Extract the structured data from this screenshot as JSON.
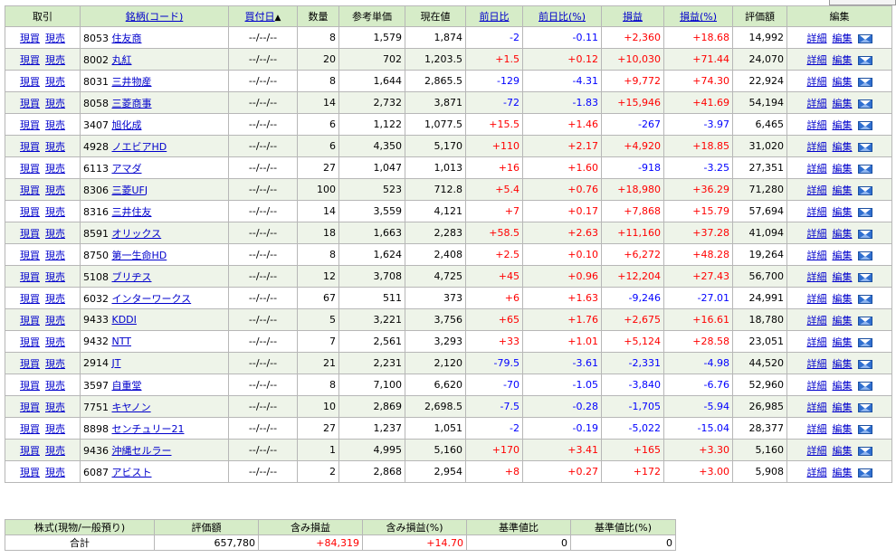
{
  "headers": {
    "trade": "取引",
    "stock": "銘柄(コード)",
    "buy_date": "買付日",
    "sort_indicator": "▲",
    "qty": "数量",
    "ref_price": "参考単価",
    "current_price": "現在値",
    "prev_diff": "前日比",
    "prev_diff_pct": "前日比(%)",
    "pl": "損益",
    "pl_pct": "損益(%)",
    "valuation": "評価額",
    "edit": "編集"
  },
  "labels": {
    "buy": "現買",
    "sell": "現売",
    "detail": "詳細",
    "edit": "編集",
    "mail_icon": "mail-icon"
  },
  "rows": [
    {
      "code": "8053",
      "name": "住友商",
      "date": "--/--/--",
      "qty": "8",
      "ref": "1,579",
      "cur": "1,874",
      "diff": "-2",
      "diffp": "-0.11",
      "pl": "+2,360",
      "plp": "+18.68",
      "val": "14,992"
    },
    {
      "code": "8002",
      "name": "丸紅",
      "date": "--/--/--",
      "qty": "20",
      "ref": "702",
      "cur": "1,203.5",
      "diff": "+1.5",
      "diffp": "+0.12",
      "pl": "+10,030",
      "plp": "+71.44",
      "val": "24,070"
    },
    {
      "code": "8031",
      "name": "三井物産",
      "date": "--/--/--",
      "qty": "8",
      "ref": "1,644",
      "cur": "2,865.5",
      "diff": "-129",
      "diffp": "-4.31",
      "pl": "+9,772",
      "plp": "+74.30",
      "val": "22,924"
    },
    {
      "code": "8058",
      "name": "三菱商事",
      "date": "--/--/--",
      "qty": "14",
      "ref": "2,732",
      "cur": "3,871",
      "diff": "-72",
      "diffp": "-1.83",
      "pl": "+15,946",
      "plp": "+41.69",
      "val": "54,194"
    },
    {
      "code": "3407",
      "name": "旭化成",
      "date": "--/--/--",
      "qty": "6",
      "ref": "1,122",
      "cur": "1,077.5",
      "diff": "+15.5",
      "diffp": "+1.46",
      "pl": "-267",
      "plp": "-3.97",
      "val": "6,465"
    },
    {
      "code": "4928",
      "name": "ノエビアHD",
      "date": "--/--/--",
      "qty": "6",
      "ref": "4,350",
      "cur": "5,170",
      "diff": "+110",
      "diffp": "+2.17",
      "pl": "+4,920",
      "plp": "+18.85",
      "val": "31,020"
    },
    {
      "code": "6113",
      "name": "アマダ",
      "date": "--/--/--",
      "qty": "27",
      "ref": "1,047",
      "cur": "1,013",
      "diff": "+16",
      "diffp": "+1.60",
      "pl": "-918",
      "plp": "-3.25",
      "val": "27,351"
    },
    {
      "code": "8306",
      "name": "三菱UFJ",
      "date": "--/--/--",
      "qty": "100",
      "ref": "523",
      "cur": "712.8",
      "diff": "+5.4",
      "diffp": "+0.76",
      "pl": "+18,980",
      "plp": "+36.29",
      "val": "71,280"
    },
    {
      "code": "8316",
      "name": "三井住友",
      "date": "--/--/--",
      "qty": "14",
      "ref": "3,559",
      "cur": "4,121",
      "diff": "+7",
      "diffp": "+0.17",
      "pl": "+7,868",
      "plp": "+15.79",
      "val": "57,694"
    },
    {
      "code": "8591",
      "name": "オリックス",
      "date": "--/--/--",
      "qty": "18",
      "ref": "1,663",
      "cur": "2,283",
      "diff": "+58.5",
      "diffp": "+2.63",
      "pl": "+11,160",
      "plp": "+37.28",
      "val": "41,094"
    },
    {
      "code": "8750",
      "name": "第一生命HD",
      "date": "--/--/--",
      "qty": "8",
      "ref": "1,624",
      "cur": "2,408",
      "diff": "+2.5",
      "diffp": "+0.10",
      "pl": "+6,272",
      "plp": "+48.28",
      "val": "19,264"
    },
    {
      "code": "5108",
      "name": "ブリヂス",
      "date": "--/--/--",
      "qty": "12",
      "ref": "3,708",
      "cur": "4,725",
      "diff": "+45",
      "diffp": "+0.96",
      "pl": "+12,204",
      "plp": "+27.43",
      "val": "56,700"
    },
    {
      "code": "6032",
      "name": "インターワークス",
      "date": "--/--/--",
      "qty": "67",
      "ref": "511",
      "cur": "373",
      "diff": "+6",
      "diffp": "+1.63",
      "pl": "-9,246",
      "plp": "-27.01",
      "val": "24,991"
    },
    {
      "code": "9433",
      "name": "KDDI",
      "date": "--/--/--",
      "qty": "5",
      "ref": "3,221",
      "cur": "3,756",
      "diff": "+65",
      "diffp": "+1.76",
      "pl": "+2,675",
      "plp": "+16.61",
      "val": "18,780"
    },
    {
      "code": "9432",
      "name": "NTT",
      "date": "--/--/--",
      "qty": "7",
      "ref": "2,561",
      "cur": "3,293",
      "diff": "+33",
      "diffp": "+1.01",
      "pl": "+5,124",
      "plp": "+28.58",
      "val": "23,051"
    },
    {
      "code": "2914",
      "name": "JT",
      "date": "--/--/--",
      "qty": "21",
      "ref": "2,231",
      "cur": "2,120",
      "diff": "-79.5",
      "diffp": "-3.61",
      "pl": "-2,331",
      "plp": "-4.98",
      "val": "44,520"
    },
    {
      "code": "3597",
      "name": "自重堂",
      "date": "--/--/--",
      "qty": "8",
      "ref": "7,100",
      "cur": "6,620",
      "diff": "-70",
      "diffp": "-1.05",
      "pl": "-3,840",
      "plp": "-6.76",
      "val": "52,960"
    },
    {
      "code": "7751",
      "name": "キヤノン",
      "date": "--/--/--",
      "qty": "10",
      "ref": "2,869",
      "cur": "2,698.5",
      "diff": "-7.5",
      "diffp": "-0.28",
      "pl": "-1,705",
      "plp": "-5.94",
      "val": "26,985"
    },
    {
      "code": "8898",
      "name": "センチュリー21",
      "date": "--/--/--",
      "qty": "27",
      "ref": "1,237",
      "cur": "1,051",
      "diff": "-2",
      "diffp": "-0.19",
      "pl": "-5,022",
      "plp": "-15.04",
      "val": "28,377"
    },
    {
      "code": "9436",
      "name": "沖縄セルラー",
      "date": "--/--/--",
      "qty": "1",
      "ref": "4,995",
      "cur": "5,160",
      "diff": "+170",
      "diffp": "+3.41",
      "pl": "+165",
      "plp": "+3.30",
      "val": "5,160"
    },
    {
      "code": "6087",
      "name": "アビスト",
      "date": "--/--/--",
      "qty": "2",
      "ref": "2,868",
      "cur": "2,954",
      "diff": "+8",
      "diffp": "+0.27",
      "pl": "+172",
      "plp": "+3.00",
      "val": "5,908"
    }
  ],
  "summary": {
    "headers": {
      "category": "株式(現物/一般預り)",
      "valuation": "評価額",
      "unrealized": "含み損益",
      "unrealized_pct": "含み損益(%)",
      "base_diff": "基準値比",
      "base_diff_pct": "基準値比(%)"
    },
    "label": "合計",
    "valuation": "657,780",
    "unrealized": "+84,319",
    "unrealized_pct": "+14.70",
    "base_diff": "0",
    "base_diff_pct": "0"
  },
  "colors": {
    "header_bg": "#d6ecc8",
    "alt_row_bg": "#eef4e9",
    "positive": "#ff0000",
    "negative": "#0000ff",
    "link": "#0000cc"
  }
}
